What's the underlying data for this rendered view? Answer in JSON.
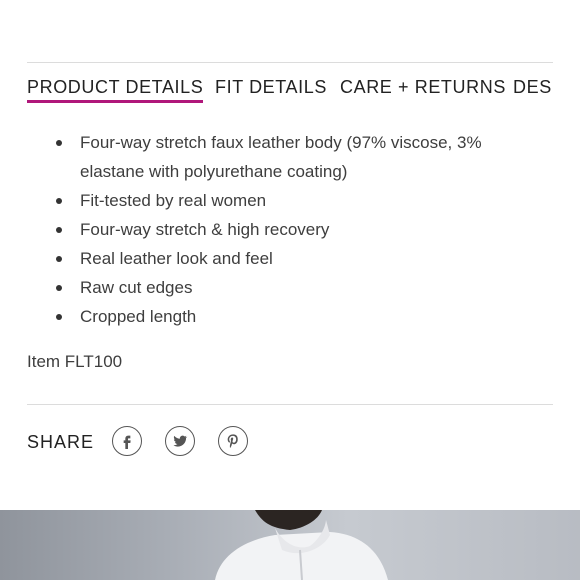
{
  "tabs": [
    {
      "label": "PRODUCT DETAILS",
      "active": true
    },
    {
      "label": "FIT DETAILS",
      "active": false
    },
    {
      "label": "CARE + RETURNS",
      "active": false
    },
    {
      "label": "DES",
      "active": false
    }
  ],
  "details": {
    "bullets": [
      "Four-way stretch faux leather body (97% viscose, 3% elastane with polyurethane coating)",
      "Fit-tested by real women",
      "Four-way stretch & high recovery",
      "Real leather look and feel",
      "Raw cut edges",
      "Cropped length"
    ],
    "item_code": "Item FLT100"
  },
  "share": {
    "label": "SHARE",
    "icons": [
      "facebook-icon",
      "twitter-icon",
      "pinterest-icon"
    ]
  },
  "colors": {
    "accent": "#b0177a",
    "text": "#3a3a3a",
    "divider": "#dcdcdc"
  }
}
